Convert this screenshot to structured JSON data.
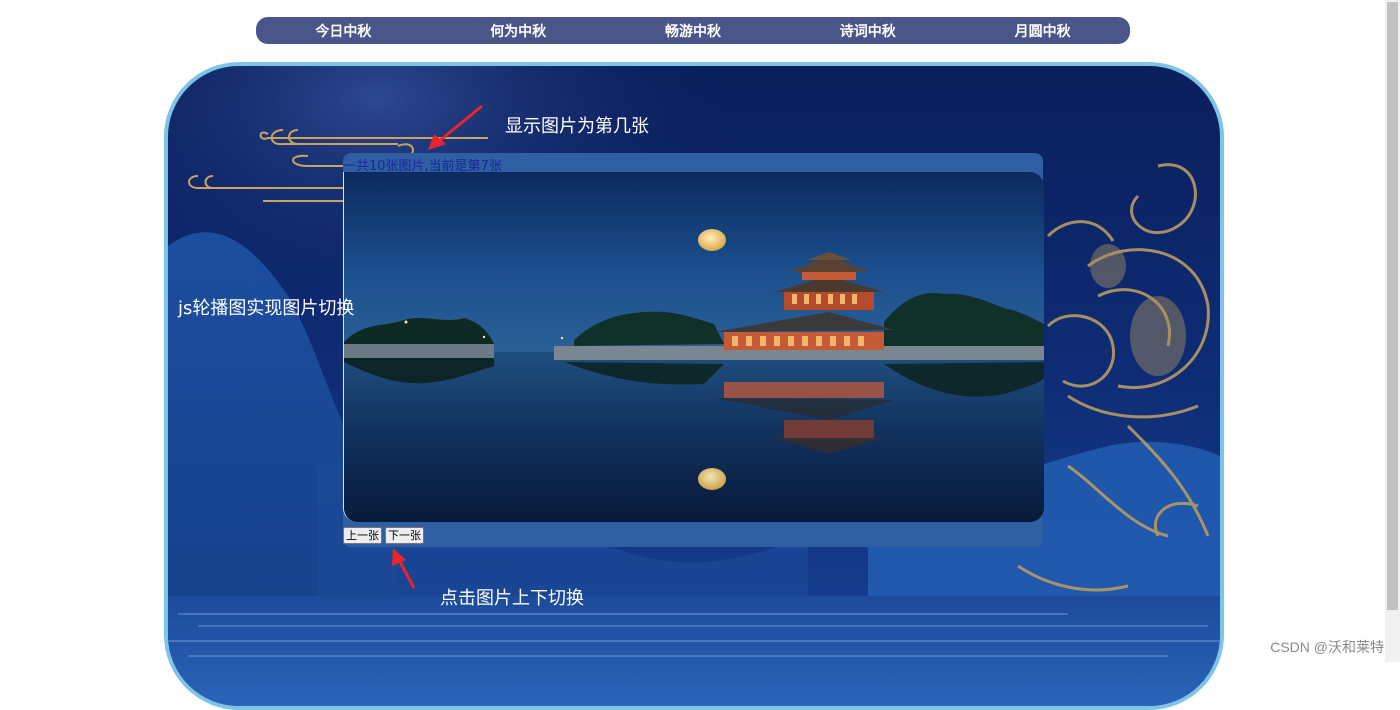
{
  "nav": {
    "items": [
      "今日中秋",
      "何为中秋",
      "畅游中秋",
      "诗词中秋",
      "月圆中秋"
    ]
  },
  "carousel": {
    "counter_text": "一共10张图片,当前是第7张",
    "total": 10,
    "current": 7,
    "prev_label": "上一张",
    "next_label": "下一张"
  },
  "annotations": {
    "counter_note": "显示图片为第几张",
    "carousel_note": "js轮播图实现图片切换",
    "buttons_note": "点击图片上下切换"
  },
  "watermark": "CSDN @沃和莱特",
  "colors": {
    "nav_bg": "#4a5589",
    "stage_border": "#7ec4e6",
    "panel_bg": "#2f5ea3",
    "counter_text": "#18279a",
    "annotation_arrow": "#e8262a"
  }
}
